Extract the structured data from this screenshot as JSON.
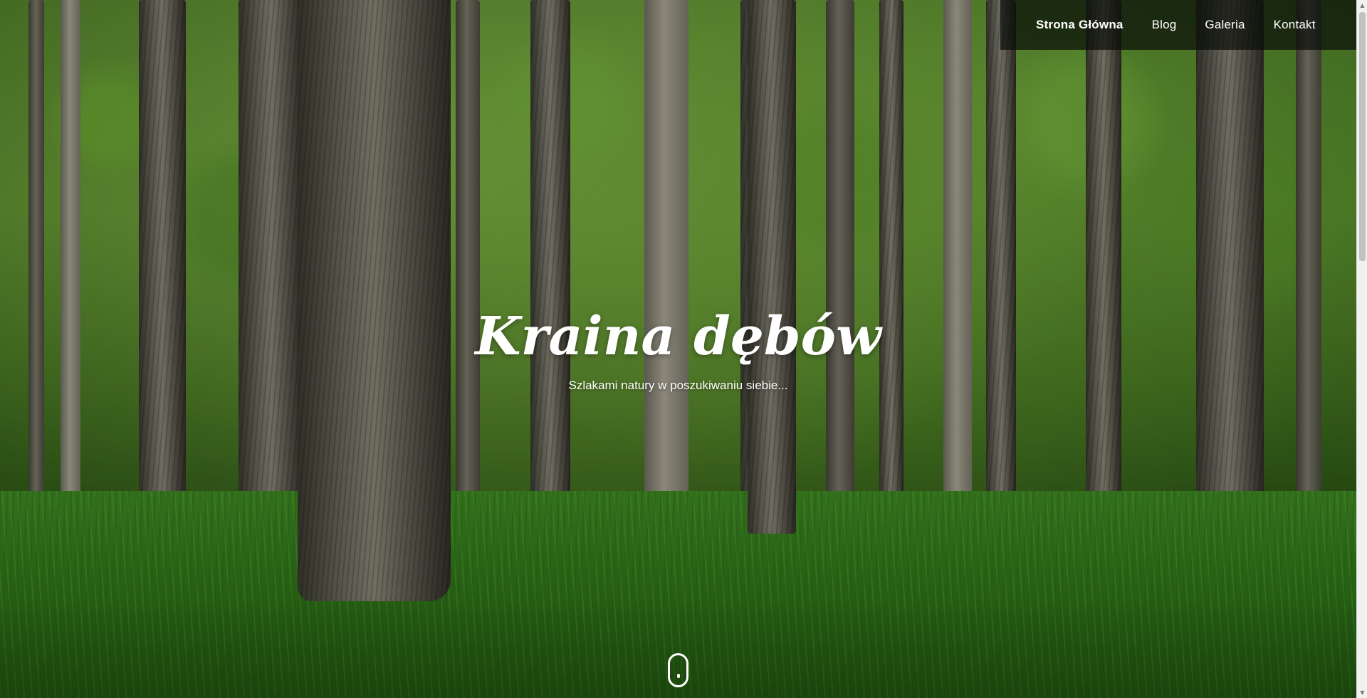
{
  "nav": {
    "items": [
      {
        "label": "Strona Główna",
        "active": true
      },
      {
        "label": "Blog",
        "active": false
      },
      {
        "label": "Galeria",
        "active": false
      },
      {
        "label": "Kontakt",
        "active": false
      }
    ]
  },
  "hero": {
    "title": "Kraina dębów",
    "subtitle": "Szlakami natury w poszukiwaniu siebie..."
  },
  "icons": {
    "scroll_indicator": "mouse-scroll-icon",
    "scrollbar_up": "▲",
    "scrollbar_down": "▼"
  },
  "colors": {
    "nav_background": "#0a0e08",
    "text": "#ffffff"
  }
}
